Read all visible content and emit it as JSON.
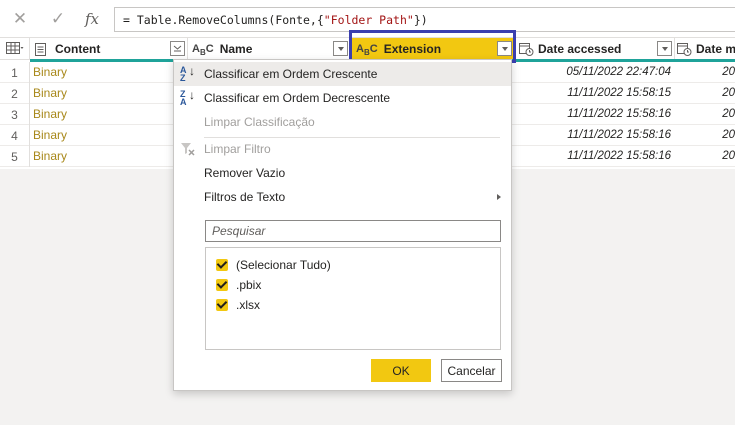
{
  "formula_bar": {
    "formula_prefix": "= Table.RemoveColumns(Fonte,{",
    "formula_string": "\"Folder Path\"",
    "formula_suffix": "})",
    "fx_label": "fx"
  },
  "columns": [
    {
      "label": "Content"
    },
    {
      "label": "Name"
    },
    {
      "label": "Extension"
    },
    {
      "label": "Date accessed"
    },
    {
      "label": "Date m"
    }
  ],
  "rows": [
    {
      "num": "1",
      "content": "Binary",
      "date_accessed": "05/11/2022 22:47:04",
      "date_m": "20"
    },
    {
      "num": "2",
      "content": "Binary",
      "date_accessed": "11/11/2022 15:58:15",
      "date_m": "20"
    },
    {
      "num": "3",
      "content": "Binary",
      "date_accessed": "11/11/2022 15:58:16",
      "date_m": "20"
    },
    {
      "num": "4",
      "content": "Binary",
      "date_accessed": "11/11/2022 15:58:16",
      "date_m": "20"
    },
    {
      "num": "5",
      "content": "Binary",
      "date_accessed": "11/11/2022 15:58:16",
      "date_m": "20"
    }
  ],
  "menu": {
    "sort_asc": "Classificar em Ordem Crescente",
    "sort_desc": "Classificar em Ordem Decrescente",
    "clear_sort": "Limpar Classificação",
    "clear_filter": "Limpar Filtro",
    "remove_empty": "Remover Vazio",
    "text_filters": "Filtros de Texto",
    "search_placeholder": "Pesquisar",
    "items": [
      {
        "label": "(Selecionar Tudo)",
        "checked": true
      },
      {
        "label": ".pbix",
        "checked": true
      },
      {
        "label": ".xlsx",
        "checked": true
      }
    ],
    "ok": "OK",
    "cancel": "Cancelar"
  },
  "colors": {
    "accent_yellow": "#f2c811",
    "teal": "#1fa39a",
    "highlight_border": "#3b3faf",
    "binary_text": "#a8881a"
  }
}
